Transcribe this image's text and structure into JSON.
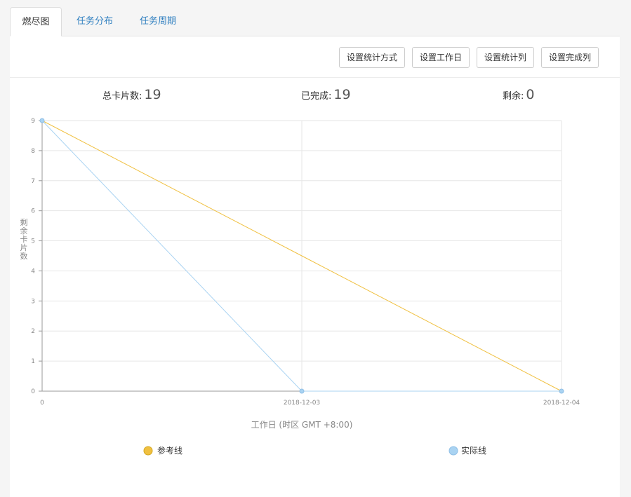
{
  "tabs": [
    {
      "label": "燃尽图",
      "active": true
    },
    {
      "label": "任务分布",
      "active": false
    },
    {
      "label": "任务周期",
      "active": false
    }
  ],
  "toolbar": {
    "buttons": [
      "设置统计方式",
      "设置工作日",
      "设置统计列",
      "设置完成列"
    ]
  },
  "stats": {
    "total_label": "总卡片数:",
    "total_value": "19",
    "done_label": "已完成:",
    "done_value": "19",
    "remaining_label": "剩余:",
    "remaining_value": "0"
  },
  "colors": {
    "reference": "#f0c040",
    "actual": "#a9d3f2",
    "tab_link": "#2f7fc0"
  },
  "chart_data": {
    "type": "line",
    "categories": [
      "0",
      "2018-12-03",
      "2018-12-04"
    ],
    "series": [
      {
        "name": "参考线",
        "values": [
          9,
          4.5,
          0
        ]
      },
      {
        "name": "实际线",
        "values": [
          9,
          0,
          0
        ]
      }
    ],
    "xlabel": "工作日 (时区 GMT +8:00)",
    "ylabel": "剩余卡片数",
    "ylim": [
      0,
      9
    ],
    "yticks": [
      0,
      1,
      2,
      3,
      4,
      5,
      6,
      7,
      8,
      9
    ],
    "grid": true,
    "legend_position": "bottom"
  }
}
